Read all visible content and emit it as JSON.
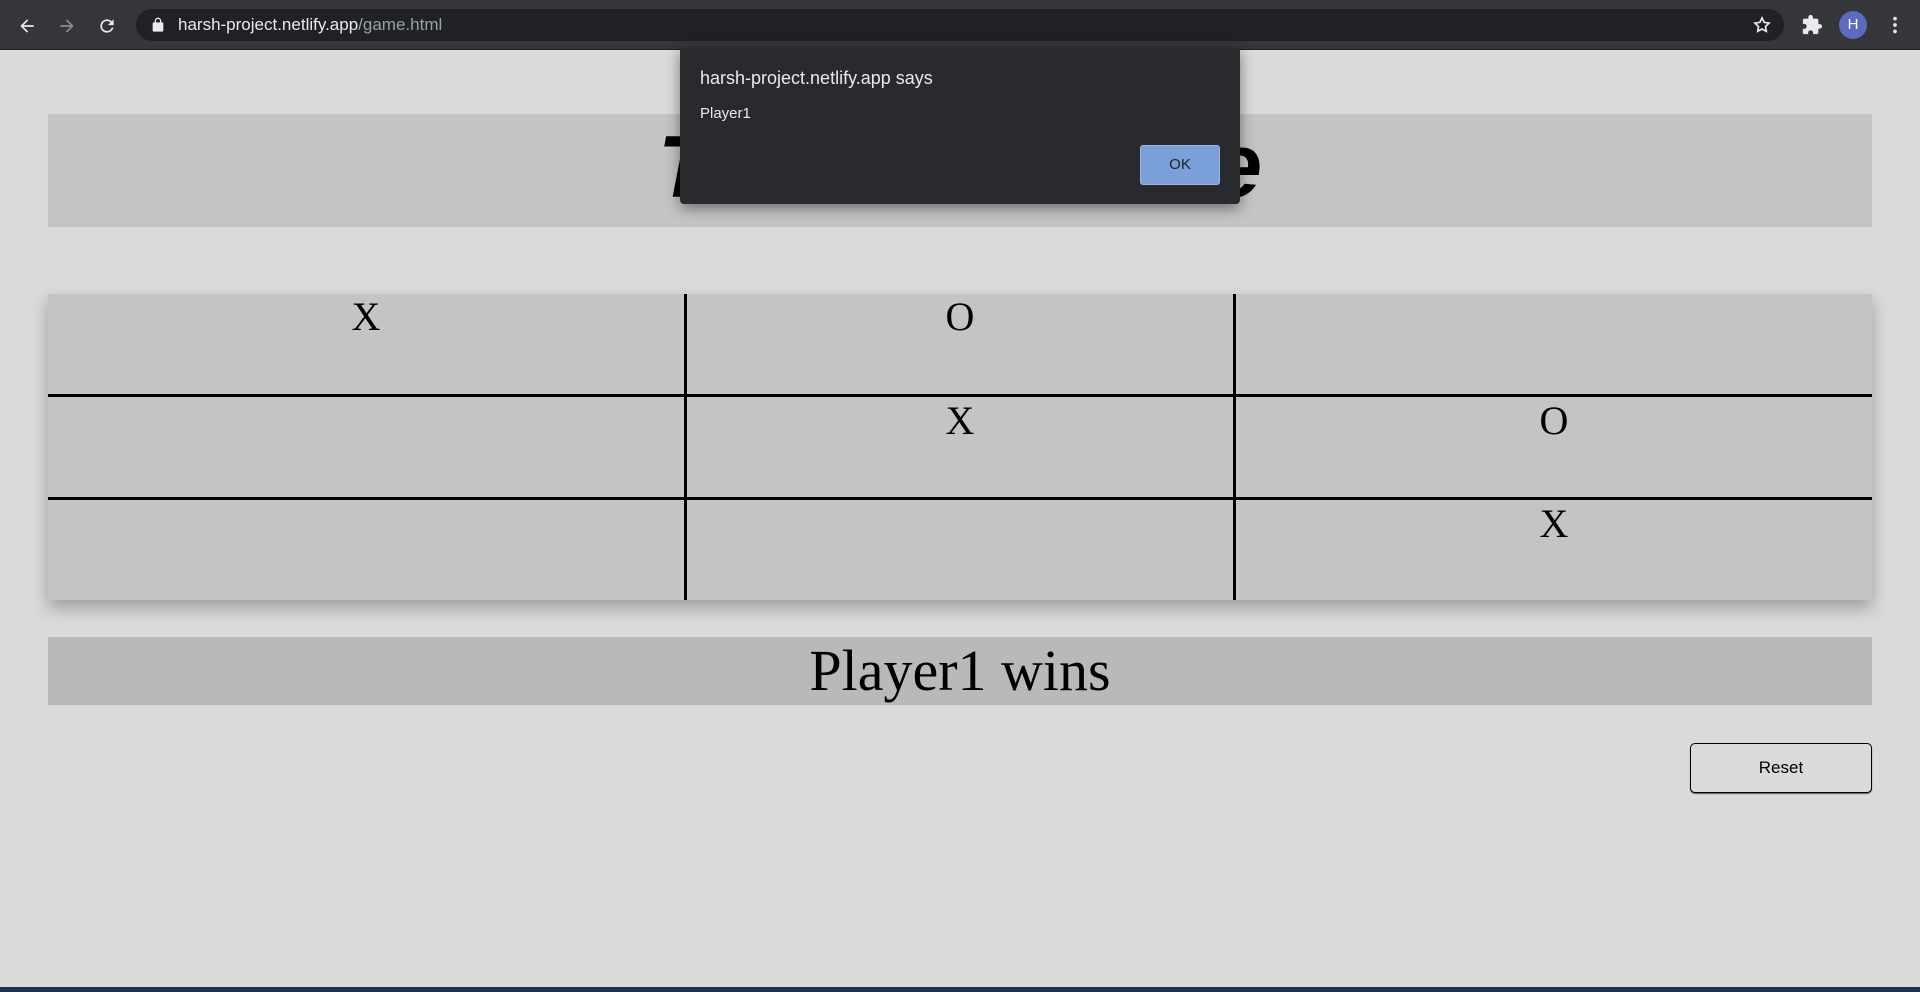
{
  "browser": {
    "url_host": "harsh-project.netlify.app",
    "url_path": "/game.html",
    "avatar_letter": "H",
    "icons": {
      "back": "arrow-left-icon",
      "forward": "arrow-right-icon",
      "reload": "reload-icon",
      "lock": "lock-icon",
      "bookmark": "star-icon",
      "extensions": "puzzle-icon",
      "menu": "kebab-menu-icon"
    }
  },
  "game": {
    "title": "Tic-Tac-Toe",
    "board": [
      [
        "X",
        "O",
        ""
      ],
      [
        "",
        "X",
        "O"
      ],
      [
        "",
        "",
        "X"
      ]
    ],
    "result": "Player1 wins",
    "reset_label": "Reset"
  },
  "dialog": {
    "title": "harsh-project.netlify.app says",
    "message": "Player1",
    "ok_label": "OK"
  },
  "colors": {
    "page_background": "#dadada",
    "panel_background": "#c4c4c4",
    "result_background": "#b9b9b9",
    "dialog_background": "#292a2d",
    "dialog_button": "#7b9fd9"
  }
}
